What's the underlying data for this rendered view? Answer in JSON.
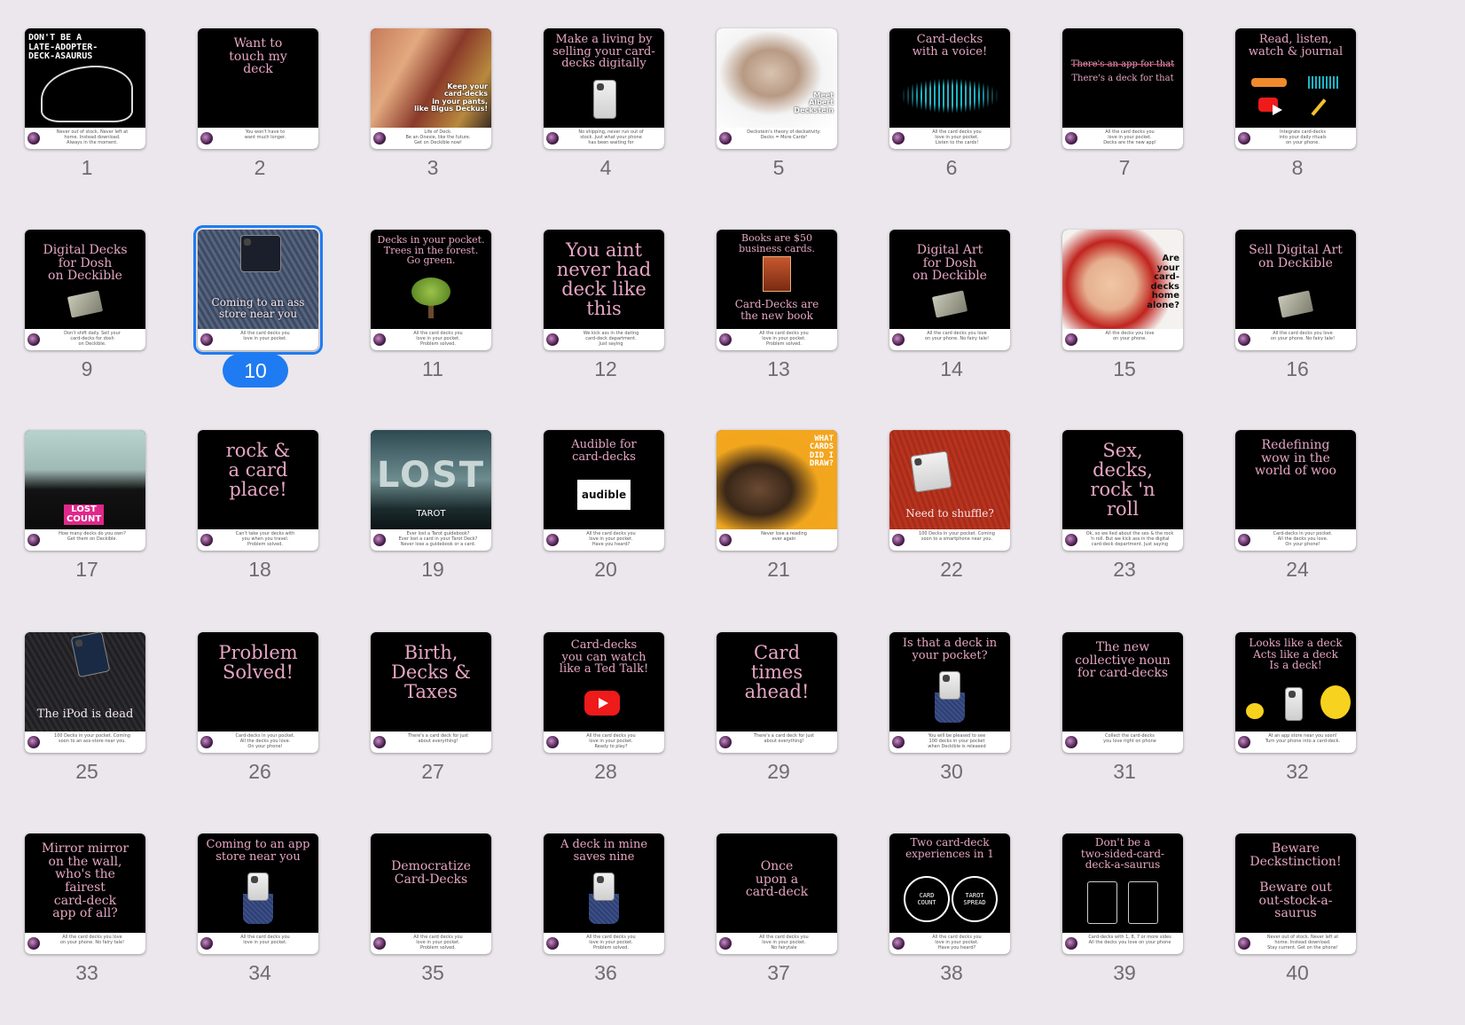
{
  "selected_index": 10,
  "accent_color": "#1f7bf2",
  "slides": [
    {
      "n": "1",
      "title": "DON'T BE A\nLATE-ADOPTER-\nDECK-ASAURUS",
      "caption": "Never out of stock. Never left at\nhome. Instead download.\nAlways in the moment.",
      "style": "dino"
    },
    {
      "n": "2",
      "title": "Want to\ntouch my\ndeck",
      "caption": "You won't have to\nwant much longer.",
      "style": "text"
    },
    {
      "n": "3",
      "title": "Keep your\ncard-decks\nin your pants,\nlike Bigus Deckus!",
      "caption": "Life of Deck.\nBe an Onesie, like the future.\nGet on Deckible now!",
      "style": "romans"
    },
    {
      "n": "4",
      "title": "Make a living by\nselling your card-\ndecks digitally",
      "caption": "No shipping, never run out of\nstock. Just what your phone\nhas been waiting for",
      "style": "phone"
    },
    {
      "n": "5",
      "title": "Meet\nAlbert\nDeckstein",
      "caption": "Deckstein's theory of deckativity:\nDecks = More Cards²",
      "style": "einstein"
    },
    {
      "n": "6",
      "title": "Card-decks\nwith a voice!",
      "caption": "All the card decks you\nlove in your pocket.\nListen to the cards!",
      "style": "wave"
    },
    {
      "n": "7",
      "title": "There's a deck for that",
      "strike": "There's an app for that",
      "caption": "All the card decks you\nlove in your pocket.\nDecks are the new app!",
      "style": "strike"
    },
    {
      "n": "8",
      "title": "Read, listen,\nwatch & journal",
      "caption": "Integrate card-decks\ninto your daily rituals\non your phone.",
      "style": "icons"
    },
    {
      "n": "9",
      "title": "Digital Decks\nfor Dosh\non Deckible",
      "caption": "Don't shift daily. Sell your\ncard-decks for dosh\non Deckible.",
      "style": "cash"
    },
    {
      "n": "10",
      "title": "Coming to an ass\nstore near you",
      "caption": "All the card decks you\nlove in your pocket.",
      "style": "jeans"
    },
    {
      "n": "11",
      "title": "Decks in your pocket.\nTrees in the forest.\nGo green.",
      "caption": "All the card decks you\nlove in your pocket.\nProblem solved.",
      "style": "tree"
    },
    {
      "n": "12",
      "title": "You aint\nnever had\ndeck like\nthis",
      "caption": "We kick ass in the dating\ncard-deck department.\nJust saying",
      "style": "bigtext"
    },
    {
      "n": "13",
      "title": "Books are $50\nbusiness cards.",
      "title2": "Card-Decks are\nthe new book",
      "caption": "All the card decks you\nlove in your pocket.\nProblem solved.",
      "style": "book"
    },
    {
      "n": "14",
      "title": "Digital Art\nfor Dosh\non Deckible",
      "caption": "All the card decks you love\non your phone. No fairy tale!",
      "style": "cash"
    },
    {
      "n": "15",
      "title": "Are\nyour\ncard-\ndecks\nhome\nalone?",
      "caption": "All the decks you love\non your phone.",
      "style": "homealone"
    },
    {
      "n": "16",
      "title": "Sell Digital Art\non Deckible",
      "caption": "All the card decks you love\non your phone. No fairy tale!",
      "style": "cash"
    },
    {
      "n": "17",
      "title": "LOST\nCOUNT",
      "caption": "How many decks do you own?\nGet them on Deckible.",
      "style": "dracula"
    },
    {
      "n": "18",
      "title": "rock &\na card\nplace!",
      "caption": "Can't take your decks with\nyou when you travel.\nProblem solved.",
      "style": "bigtext"
    },
    {
      "n": "19",
      "title": "LOST",
      "title2": "TAROT",
      "caption": "Ever lost a Tarot guidebook?\nEver lost a card in your Tarot Deck?\nNever lose a guidebook or a card.",
      "style": "lost"
    },
    {
      "n": "20",
      "title": "Audible for\ncard-decks",
      "badge": "audible",
      "caption": "All the card decks you\nlove in your pocket.\nHave you heard?",
      "style": "audible"
    },
    {
      "n": "21",
      "title": "WHAT\nCARDS\nDID I\nDRAW?",
      "caption": "Never lose a reading\never again",
      "style": "yellow"
    },
    {
      "n": "22",
      "title": "Need to shuffle?",
      "caption": "100 Decks in your pocket. Coming\nsoon to a smartphone near you.",
      "style": "redjeans"
    },
    {
      "n": "23",
      "title": "Sex,\ndecks,\nrock 'n\nroll",
      "caption": "Ok, so we lied about the sex & the rock\n'n roll. But we kick ass in the digital\ncard-deck department. Just saying",
      "style": "bigtext"
    },
    {
      "n": "24",
      "title": "Redefining\nwow in the\nworld of woo",
      "caption": "Card-decks in your pocket.\nAll the decks you love.\nOn your phone!",
      "style": "text"
    },
    {
      "n": "25",
      "title": "The iPod is dead",
      "caption": "100 Decks in your pocket. Coming\nsoon to an ass-store near you.",
      "style": "blackjeans"
    },
    {
      "n": "26",
      "title": "Problem\nSolved!",
      "caption": "Card-decks in your pocket.\nAll the decks you love.\nOn your phone!",
      "style": "bigtext"
    },
    {
      "n": "27",
      "title": "Birth,\nDecks &\nTaxes",
      "caption": "There's a card deck for just\nabout everything!",
      "style": "bigtext"
    },
    {
      "n": "28",
      "title": "Card-decks\nyou can watch\nlike a Ted Talk!",
      "caption": "All the card decks you\nlove in your pocket.\nReady to play?",
      "style": "youtube"
    },
    {
      "n": "29",
      "title": "Card\ntimes\nahead!",
      "caption": "There's a card deck for just\nabout everything!",
      "style": "bigtext"
    },
    {
      "n": "30",
      "title": "Is that a deck in\nyour pocket?",
      "caption": "You will be pleased to see\n100 decks in your pocket\nwhen Deckible is released",
      "style": "pocket"
    },
    {
      "n": "31",
      "title": "The new\ncollective noun\nfor card-decks",
      "caption": "Collect the card-decks\nyou love right on phone",
      "style": "text"
    },
    {
      "n": "32",
      "title": "Looks like a deck\nActs like a deck\nIs a deck!",
      "caption": "At an app store near you soon!\nTurn your phone into a card-deck.",
      "style": "ducks"
    },
    {
      "n": "33",
      "title": "Mirror mirror\non the wall,\nwho's the\nfairest\ncard-deck\napp of all?",
      "caption": "All the card decks you love\non your phone. No fairy tale!",
      "style": "text"
    },
    {
      "n": "34",
      "title": "Coming to an app\nstore near you",
      "caption": "All the card decks you\nlove in your pocket.",
      "style": "pocket"
    },
    {
      "n": "35",
      "title": "Democratize\nCard-Decks",
      "caption": "All the card decks you\nlove in your pocket.\nProblem solved.",
      "style": "midtext"
    },
    {
      "n": "36",
      "title": "A deck in mine\nsaves nine",
      "caption": "All the card decks you\nlove in your pocket.\nProblem solved.",
      "style": "pocket"
    },
    {
      "n": "37",
      "title": "Once\nupon a\ncard-deck",
      "caption": "All the card decks you\nlove in your pocket.\nNo fairytale",
      "style": "midtext"
    },
    {
      "n": "38",
      "title": "Two card-deck\nexperiences in 1",
      "left": "CARD\nCOUNT",
      "right": "TAROT\nSPREAD",
      "caption": "All the card decks you\nlove in your pocket.\nHave you heard?",
      "style": "circles"
    },
    {
      "n": "39",
      "title": "Don't be a\ntwo-sided-card-\ndeck-a-saurus",
      "caption": "Card-decks with 1, 8, 7 or more sides\nAll the decks you love on your phone",
      "style": "cards"
    },
    {
      "n": "40",
      "title": "Beware\nDeckstinction!\n\nBeware out\nout-stock-a-saurus",
      "caption": "Never out of stock. Never left at\nhome. Instead download.\nStay current. Get on the phone!",
      "style": "text"
    }
  ]
}
